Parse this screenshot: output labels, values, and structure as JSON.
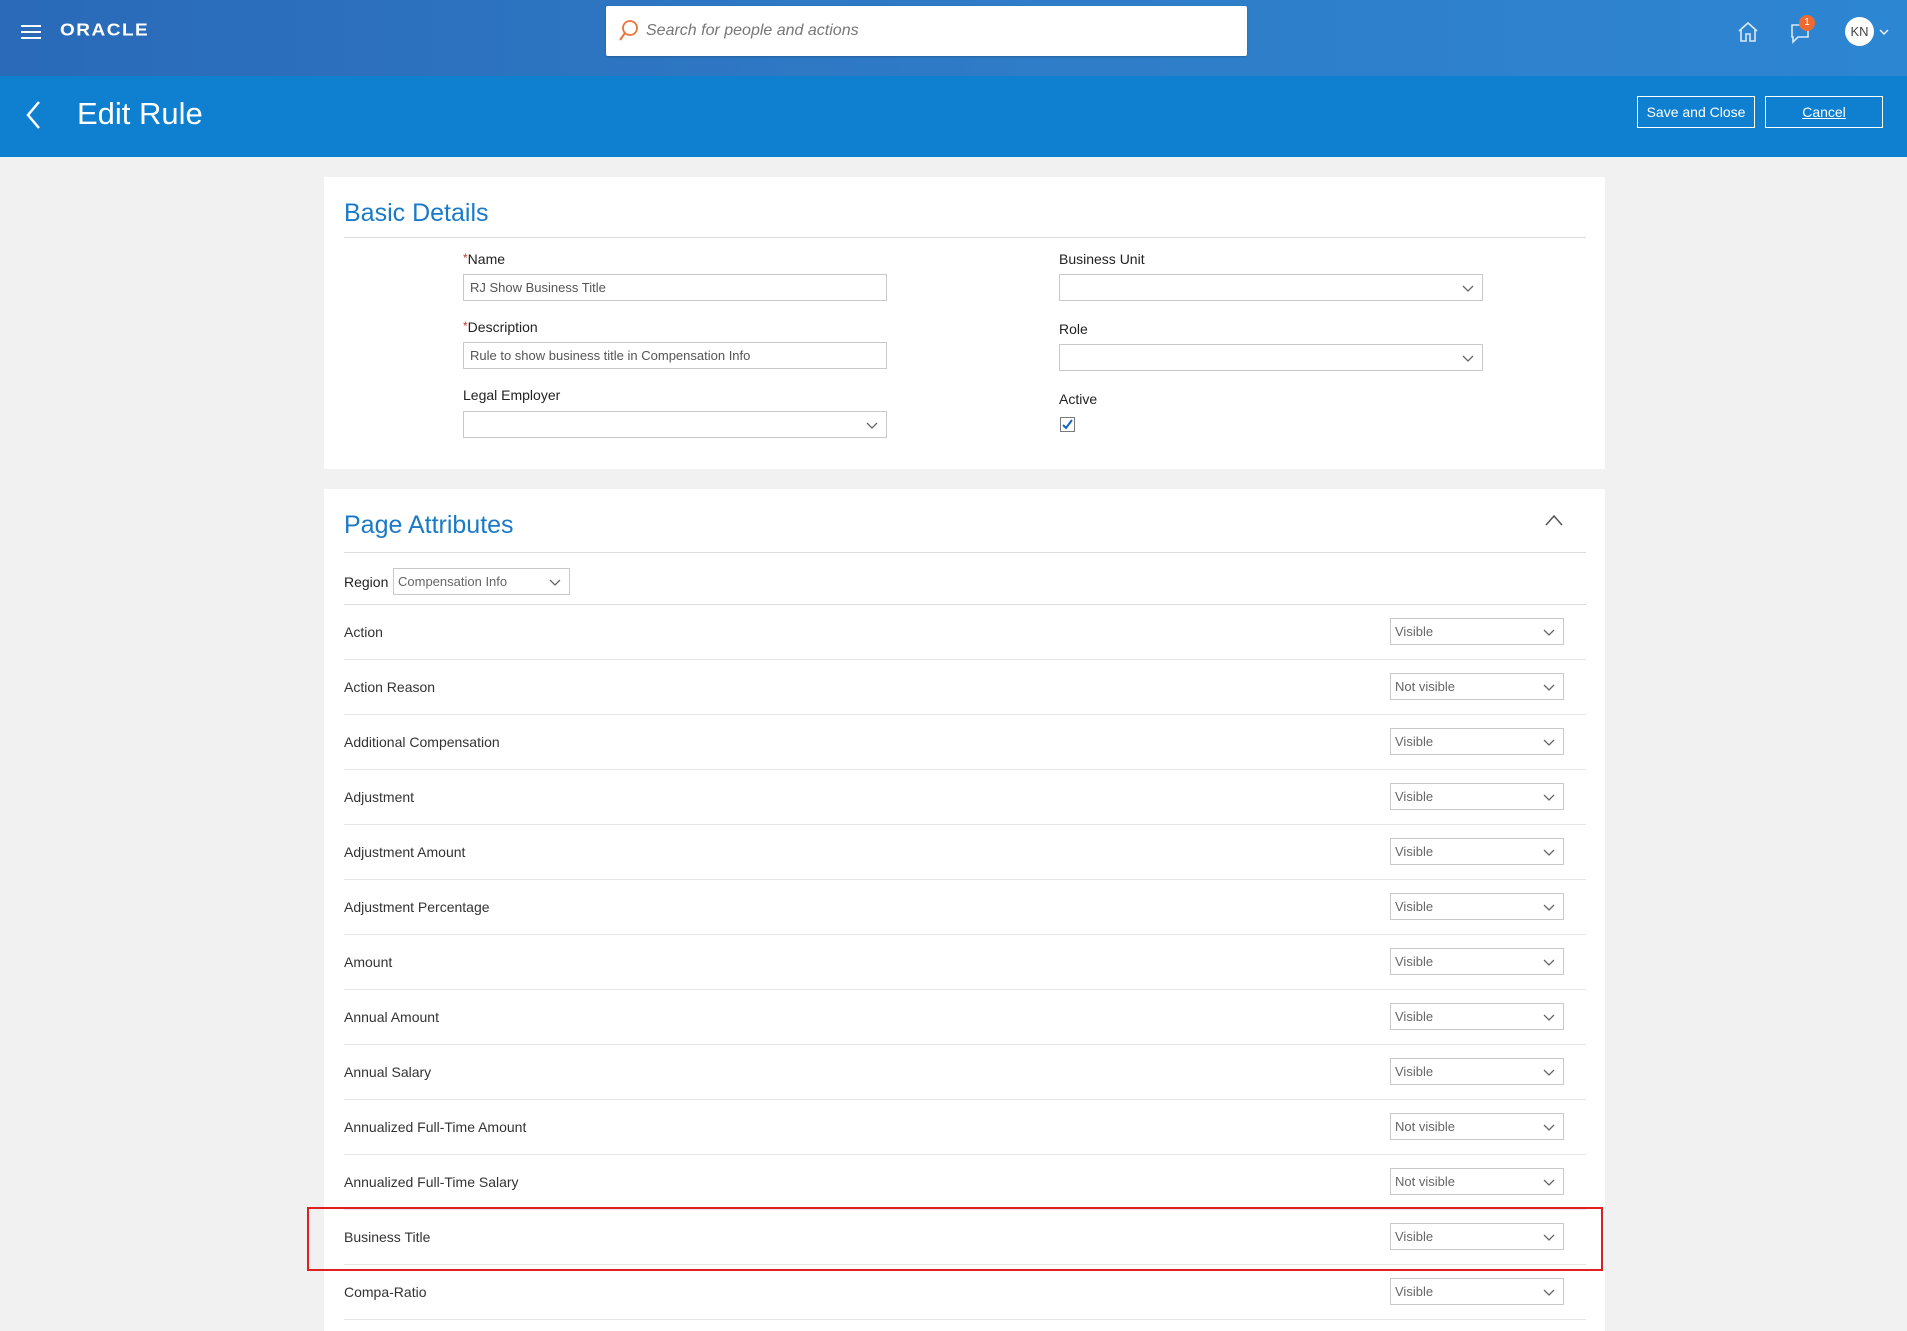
{
  "header": {
    "logo": "ORACLE",
    "search_placeholder": "Search for people and actions",
    "notification_count": "1",
    "user_initials": "KN"
  },
  "page": {
    "title": "Edit Rule",
    "save_close_label": "Save and Close",
    "cancel_label": "Cancel"
  },
  "basic_details": {
    "title": "Basic Details",
    "name_label": "Name",
    "name_value": "RJ Show Business Title",
    "description_label": "Description",
    "description_value": "Rule to show business title in Compensation Info",
    "legal_employer_label": "Legal Employer",
    "legal_employer_value": "",
    "business_unit_label": "Business Unit",
    "business_unit_value": "",
    "role_label": "Role",
    "role_value": "",
    "active_label": "Active",
    "active_checked": true,
    "required_marker": "*"
  },
  "page_attributes": {
    "title": "Page Attributes",
    "region_label": "Region",
    "region_value": "Compensation Info",
    "rows": [
      {
        "name": "Action",
        "value": "Visible"
      },
      {
        "name": "Action Reason",
        "value": "Not visible"
      },
      {
        "name": "Additional Compensation",
        "value": "Visible"
      },
      {
        "name": "Adjustment",
        "value": "Visible"
      },
      {
        "name": "Adjustment Amount",
        "value": "Visible"
      },
      {
        "name": "Adjustment Percentage",
        "value": "Visible"
      },
      {
        "name": "Amount",
        "value": "Visible"
      },
      {
        "name": "Annual Amount",
        "value": "Visible"
      },
      {
        "name": "Annual Salary",
        "value": "Visible"
      },
      {
        "name": "Annualized Full-Time Amount",
        "value": "Not visible"
      },
      {
        "name": "Annualized Full-Time Salary",
        "value": "Not visible"
      },
      {
        "name": "Business Title",
        "value": "Visible"
      },
      {
        "name": "Compa-Ratio",
        "value": "Visible"
      }
    ],
    "highlighted_row": "Business Title"
  },
  "colors": {
    "topbar": "#2f7cc8",
    "pagebar": "#0f80d0",
    "section_title": "#1a7ac7",
    "highlight": "#e02020",
    "badge": "#ef6a30"
  }
}
